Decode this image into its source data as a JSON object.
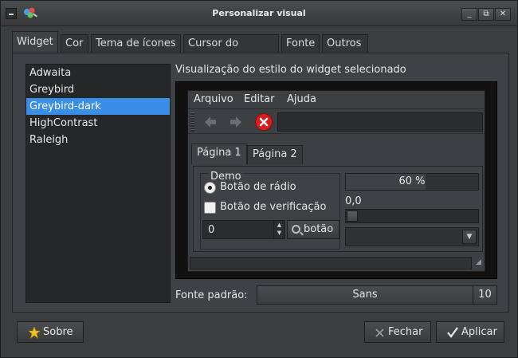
{
  "window": {
    "title": "Personalizar visual",
    "controls": {
      "minimize": "_",
      "maximize": "⧉",
      "close": "✕"
    }
  },
  "tabs": [
    {
      "label": "Widget",
      "active": true
    },
    {
      "label": "Cor"
    },
    {
      "label": "Tema de ícones"
    },
    {
      "label": "Cursor do mouse"
    },
    {
      "label": "Fonte"
    },
    {
      "label": "Outros"
    }
  ],
  "themes": {
    "items": [
      "Adwaita",
      "Greybird",
      "Greybird-dark",
      "HighContrast",
      "Raleigh"
    ],
    "selected": "Greybird-dark"
  },
  "preview": {
    "label": "Visualização do estilo do widget selecionado",
    "menu": [
      "Arquivo",
      "Editar",
      "Ajuda"
    ],
    "notebook_tabs": [
      "Página 1",
      "Página 2"
    ],
    "demo": {
      "frame_label": "Demo",
      "radio_label": "Botão de rádio",
      "radio_checked": true,
      "check_label": "Botão de verificação",
      "check_checked": false,
      "spin_value": "0",
      "search_label": "botão"
    },
    "progress": {
      "fraction": 0.6,
      "text": "60 %"
    },
    "scale": {
      "value_text": "0,0",
      "value": 0
    },
    "combo_value": ""
  },
  "font": {
    "label": "Fonte padrão:",
    "name": "Sans",
    "size": "10"
  },
  "buttons": {
    "about": "Sobre",
    "close": "Fechar",
    "apply": "Aplicar"
  },
  "icons": {
    "about": "star-icon",
    "close": "close-icon",
    "apply": "check-icon",
    "back": "arrow-left-icon",
    "forward": "arrow-right-icon",
    "stop": "stop-icon"
  }
}
